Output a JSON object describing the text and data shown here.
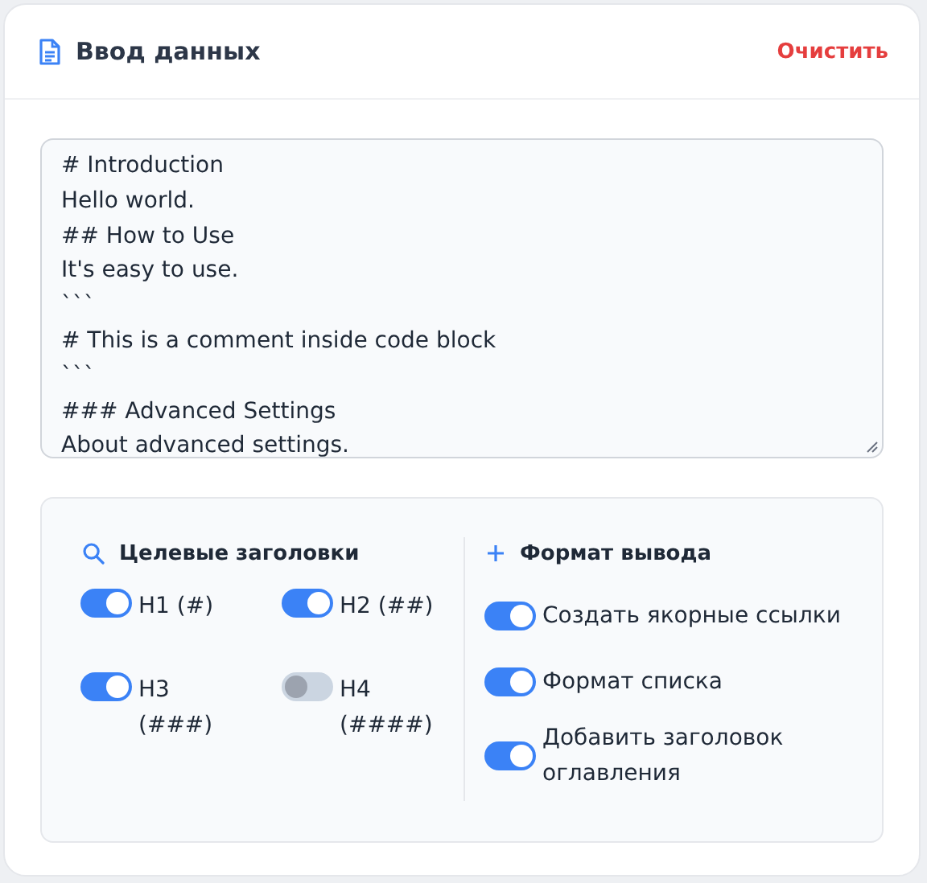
{
  "header": {
    "title": "Ввод данных",
    "clear_button": "Очистить"
  },
  "editor": {
    "value": "# Introduction\nHello world.\n## How to Use\nIt's easy to use.\n```\n# This is a comment inside code block\n```\n### Advanced Settings\nAbout advanced settings."
  },
  "options": {
    "target_headings": {
      "title": "Целевые заголовки",
      "items": [
        {
          "label": "H1 (#)",
          "on": true
        },
        {
          "label": "H2 (##)",
          "on": true
        },
        {
          "label": "H3 (###)",
          "on": true
        },
        {
          "label": "H4 (####)",
          "on": false
        }
      ]
    },
    "output_format": {
      "title": "Формат вывода",
      "items": [
        {
          "label": "Создать якорные ссылки",
          "on": true
        },
        {
          "label": "Формат списка",
          "on": true
        },
        {
          "label": "Добавить заголовок оглавления",
          "on": true
        }
      ]
    }
  }
}
